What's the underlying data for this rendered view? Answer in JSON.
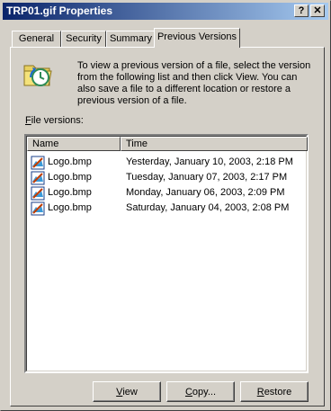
{
  "window": {
    "title": "TRP01.gif Properties",
    "help_glyph": "?",
    "close_glyph": "✕"
  },
  "tabs": [
    {
      "label": "General"
    },
    {
      "label": "Security"
    },
    {
      "label": "Summary"
    },
    {
      "label": "Previous Versions",
      "active": true
    }
  ],
  "info": {
    "icon": "previous-versions-folder-icon",
    "text": "To view a previous version of a file, select the version from the following list and then click View.  You can also save a file to a different location or restore a previous version of a file."
  },
  "versions_label": {
    "accel": "F",
    "rest": "ile versions:"
  },
  "columns": {
    "name": "Name",
    "time": "Time"
  },
  "rows": [
    {
      "name": "Logo.bmp",
      "time": "Yesterday, January 10, 2003, 2:18 PM"
    },
    {
      "name": "Logo.bmp",
      "time": "Tuesday, January 07, 2003, 2:17 PM"
    },
    {
      "name": "Logo.bmp",
      "time": "Monday, January 06, 2003, 2:09 PM"
    },
    {
      "name": "Logo.bmp",
      "time": "Saturday, January 04, 2003, 2:08 PM"
    }
  ],
  "buttons": {
    "view": {
      "accel": "V",
      "rest": "iew"
    },
    "copy": {
      "accel": "C",
      "rest": "opy..."
    },
    "restore": {
      "accel": "R",
      "rest": "estore"
    }
  },
  "colors": {
    "title_start": "#0a246a",
    "title_end": "#a6caf0",
    "face": "#d4d0c8"
  }
}
